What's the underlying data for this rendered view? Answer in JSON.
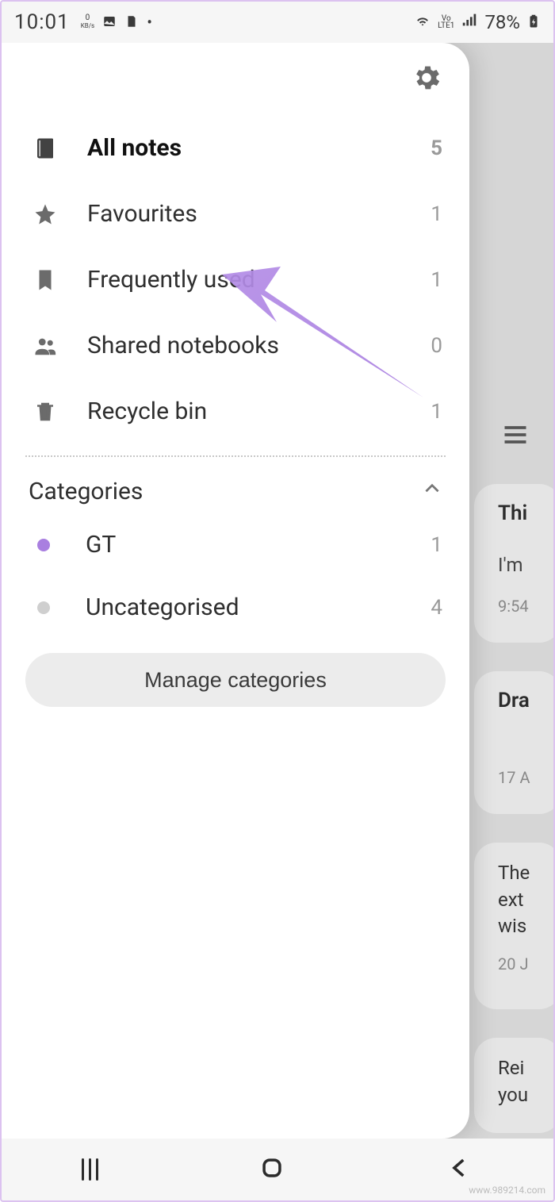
{
  "status": {
    "time": "10:01",
    "net_speed_top": "0",
    "net_speed_unit": "KB/s",
    "lte_label": "Vo\nLTE1",
    "battery_pct": "78%"
  },
  "drawer": {
    "items": [
      {
        "label": "All notes",
        "count": "5"
      },
      {
        "label": "Favourites",
        "count": "1"
      },
      {
        "label": "Frequently used",
        "count": "1"
      },
      {
        "label": "Shared notebooks",
        "count": "0"
      },
      {
        "label": "Recycle bin",
        "count": "1"
      }
    ],
    "categories_label": "Categories",
    "categories": [
      {
        "label": "GT",
        "count": "1"
      },
      {
        "label": "Uncategorised",
        "count": "4"
      }
    ],
    "manage_label": "Manage categories"
  },
  "background": {
    "cards": [
      {
        "title": "Thi",
        "sub": "I'm",
        "time": "9:54"
      },
      {
        "title": "Dra",
        "time": "17 A"
      },
      {
        "body1": "The",
        "body2": "ext",
        "body3": "wis",
        "time": "20 J"
      },
      {
        "body1": "Rei",
        "body2": "you"
      }
    ]
  },
  "watermark": "www.989214.com"
}
